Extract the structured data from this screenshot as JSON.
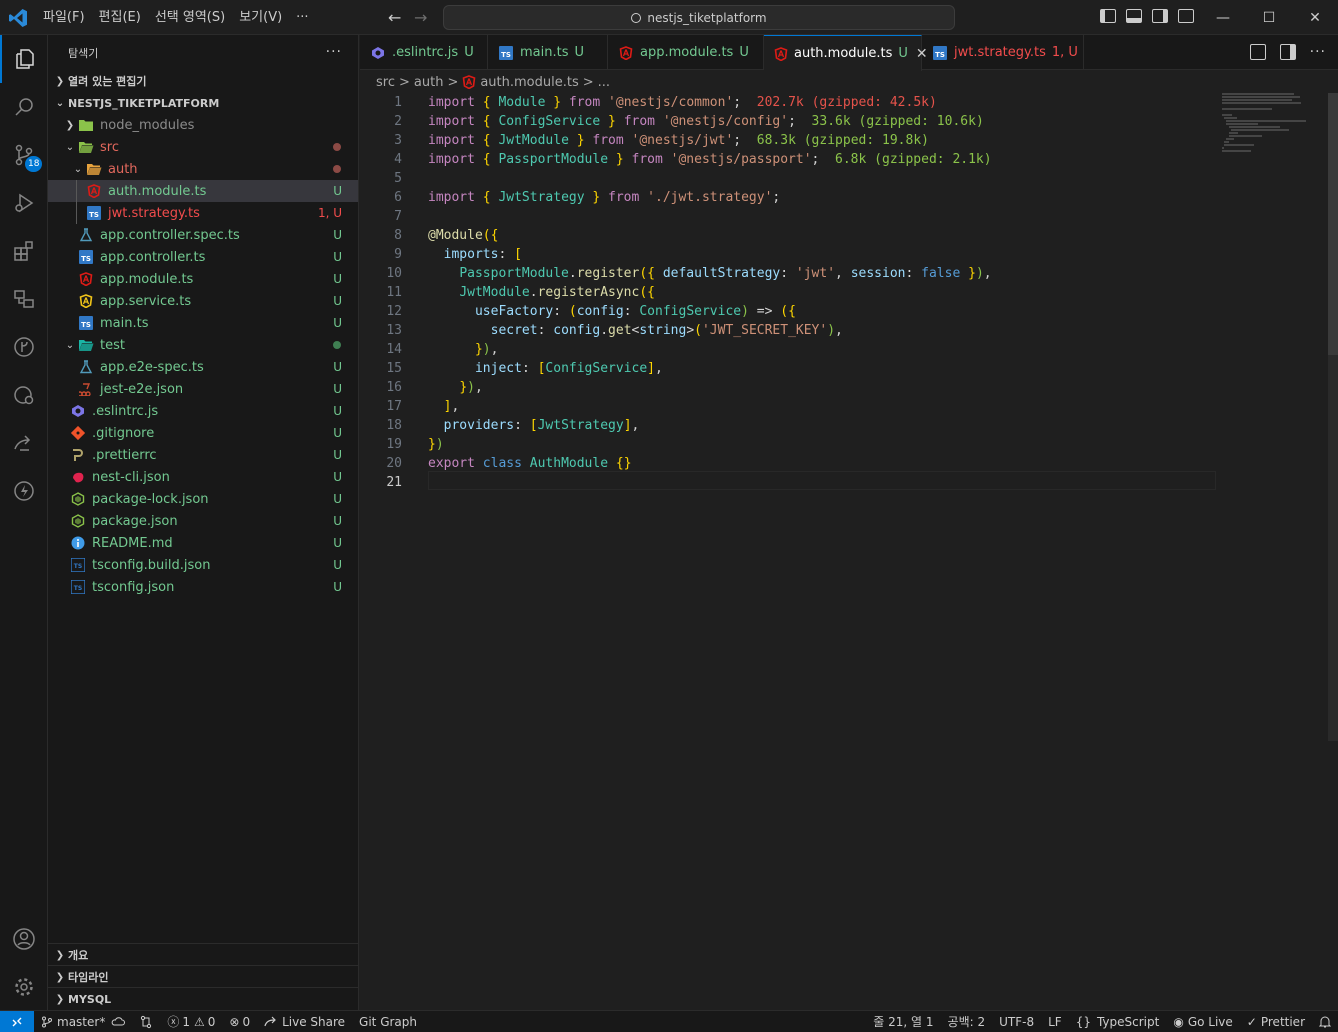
{
  "titlebar": {
    "menu": [
      "파일(F)",
      "편집(E)",
      "선택 영역(S)",
      "보기(V)",
      "···"
    ],
    "search_text": "nestjs_tiketplatform",
    "back_arrow": "←",
    "forward_arrow": "→",
    "window_controls": {
      "minimize": "—",
      "maximize": "☐",
      "close": "✕"
    }
  },
  "activity_bar": {
    "source_control_badge": "18",
    "icons": [
      "files-icon",
      "search-icon",
      "source-control-icon",
      "run-debug-icon",
      "extensions-icon",
      "remote-explorer-icon",
      "git-graph-icon",
      "docker-icon",
      "live-share-icon",
      "thunder-client-icon",
      "account-icon",
      "settings-gear-icon"
    ]
  },
  "sidebar": {
    "title": "탐색기",
    "more": "···",
    "open_editors": "열려 있는 편집기",
    "project": "NESTJS_TIKETPLATFORM",
    "tree": [
      {
        "name": "node_modules",
        "status": "",
        "color": "#8b8b8b",
        "icon": "folder",
        "icon_color": "#8bc34a"
      },
      {
        "name": "src",
        "status": "dot",
        "color": "#e2685d",
        "icon": "folder-open",
        "icon_color": "#8bc34a"
      },
      {
        "name": "auth",
        "status": "dot",
        "color": "#e2685d",
        "icon": "folder-open",
        "icon_color": "#e8a33d"
      },
      {
        "name": "auth.module.ts",
        "status": "U",
        "color": "#73c991",
        "icon": "angular",
        "icon_color": "#dd1b16"
      },
      {
        "name": "jwt.strategy.ts",
        "status": "1, U",
        "color": "#f14c4c",
        "icon": "ts",
        "icon_color": "#3178c6"
      },
      {
        "name": "app.controller.spec.ts",
        "status": "U",
        "color": "#73c991",
        "icon": "test",
        "icon_color": "#519aba"
      },
      {
        "name": "app.controller.ts",
        "status": "U",
        "color": "#73c991",
        "icon": "ts",
        "icon_color": "#3178c6"
      },
      {
        "name": "app.module.ts",
        "status": "U",
        "color": "#73c991",
        "icon": "angular",
        "icon_color": "#dd1b16"
      },
      {
        "name": "app.service.ts",
        "status": "U",
        "color": "#73c991",
        "icon": "angular-svc",
        "icon_color": "#f0c419"
      },
      {
        "name": "main.ts",
        "status": "U",
        "color": "#73c991",
        "icon": "ts",
        "icon_color": "#3178c6"
      },
      {
        "name": "test",
        "status": "dot-green",
        "color": "#73c991",
        "icon": "folder-open",
        "icon_color": "#19b5a5"
      },
      {
        "name": "app.e2e-spec.ts",
        "status": "U",
        "color": "#73c991",
        "icon": "test",
        "icon_color": "#519aba"
      },
      {
        "name": "jest-e2e.json",
        "status": "U",
        "color": "#73c991",
        "icon": "jest",
        "icon_color": "#c94a30"
      },
      {
        "name": ".eslintrc.js",
        "status": "U",
        "color": "#73c991",
        "icon": "eslint",
        "icon_color": "#7c75e6"
      },
      {
        "name": ".gitignore",
        "status": "U",
        "color": "#73c991",
        "icon": "git",
        "icon_color": "#f0532a"
      },
      {
        "name": ".prettierrc",
        "status": "U",
        "color": "#73c991",
        "icon": "prettier",
        "icon_color": "#b0a36b"
      },
      {
        "name": "nest-cli.json",
        "status": "U",
        "color": "#73c991",
        "icon": "nest",
        "icon_color": "#e0234e"
      },
      {
        "name": "package-lock.json",
        "status": "U",
        "color": "#73c991",
        "icon": "npm",
        "icon_color": "#8bc34a"
      },
      {
        "name": "package.json",
        "status": "U",
        "color": "#73c991",
        "icon": "npm",
        "icon_color": "#8bc34a"
      },
      {
        "name": "README.md",
        "status": "U",
        "color": "#73c991",
        "icon": "info",
        "icon_color": "#3f9be8"
      },
      {
        "name": "tsconfig.build.json",
        "status": "U",
        "color": "#73c991",
        "icon": "tsconfig",
        "icon_color": "#3178c6"
      },
      {
        "name": "tsconfig.json",
        "status": "U",
        "color": "#73c991",
        "icon": "tsconfig",
        "icon_color": "#3178c6"
      }
    ],
    "bottom_sections": [
      "개요",
      "타임라인",
      "MYSQL"
    ]
  },
  "tabs": [
    {
      "label": ".eslintrc.js",
      "status": "U",
      "color": "#73c991",
      "icon": "eslint",
      "icon_color": "#7c75e6"
    },
    {
      "label": "main.ts",
      "status": "U",
      "color": "#73c991",
      "icon": "ts",
      "icon_color": "#3178c6"
    },
    {
      "label": "app.module.ts",
      "status": "U",
      "color": "#73c991",
      "icon": "angular",
      "icon_color": "#dd1b16"
    },
    {
      "label": "auth.module.ts",
      "status": "U",
      "color": "#73c991",
      "icon": "angular",
      "icon_color": "#dd1b16",
      "active": true
    },
    {
      "label": "jwt.strategy.ts",
      "status": "1, U",
      "color": "#f14c4c",
      "icon": "ts",
      "icon_color": "#3178c6"
    }
  ],
  "breadcrumb": [
    "src",
    ">",
    "auth",
    ">",
    "auth.module.ts",
    ">",
    "..."
  ],
  "code": {
    "current_line": 21,
    "lines": [
      "import { Module } from '@nestjs/common';  202.7k (gzipped: 42.5k)",
      "import { ConfigService } from '@nestjs/config';  33.6k (gzipped: 10.6k)",
      "import { JwtModule } from '@nestjs/jwt';  68.3k (gzipped: 19.8k)",
      "import { PassportModule } from '@nestjs/passport';  6.8k (gzipped: 2.1k)",
      "",
      "import { JwtStrategy } from './jwt.strategy';",
      "",
      "@Module({",
      "  imports: [",
      "    PassportModule.register({ defaultStrategy: 'jwt', session: false }),",
      "    JwtModule.registerAsync({",
      "      useFactory: (config: ConfigService) => ({",
      "        secret: config.get<string>('JWT_SECRET_KEY'),",
      "      }),",
      "      inject: [ConfigService],",
      "    }),",
      "  ],",
      "  providers: [JwtStrategy],",
      "})",
      "export class AuthModule {}",
      ""
    ]
  },
  "statusbar": {
    "remote": "⚡",
    "branch": "master*",
    "errors": "1",
    "warnings": "0",
    "ports": "0",
    "live_share": "Live Share",
    "git_graph": "Git Graph",
    "position": "줄 21, 열 1",
    "spaces": "공백: 2",
    "encoding": "UTF-8",
    "eol": "LF",
    "language": "TypeScript",
    "go_live": "Go Live",
    "prettier": "Prettier"
  }
}
